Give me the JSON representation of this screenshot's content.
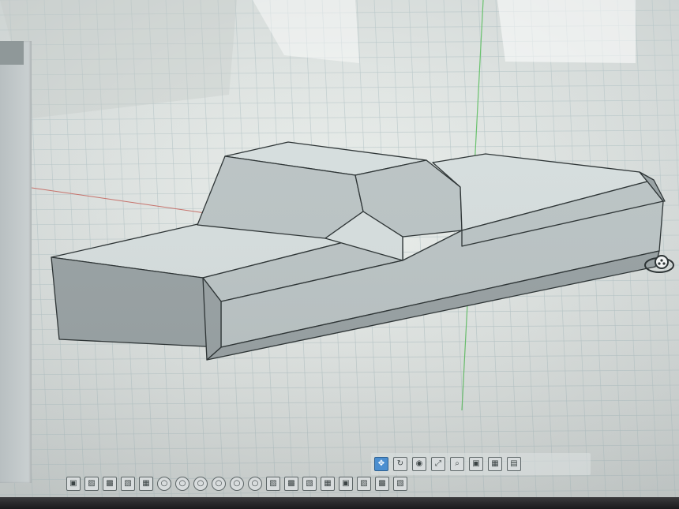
{
  "workspace": {
    "background": "#e4e8e6",
    "grid_color": "#b8c7c9",
    "axis_green": "#68c26c",
    "axis_red": "#c8716a"
  },
  "model": {
    "name_icon": "sedan-block-model",
    "face_light": "#d7dfdf",
    "face_mid": "#bcc5c6",
    "face_dark": "#9aa3a5",
    "edge_color": "#2b3233"
  },
  "view_cube": {
    "icon": "orbit-view-cube-icon"
  },
  "nav_toolbar": {
    "items": [
      {
        "icon": "pan-icon",
        "active": true
      },
      {
        "icon": "orbit-icon",
        "active": false
      },
      {
        "icon": "look-icon",
        "active": false
      },
      {
        "icon": "fit-icon",
        "active": false
      },
      {
        "icon": "zoom-icon",
        "active": false
      },
      {
        "icon": "display-mode-icon",
        "active": false
      },
      {
        "icon": "grid-settings-icon",
        "active": false
      },
      {
        "icon": "viewports-icon",
        "active": false
      }
    ]
  },
  "timeline": {
    "count": 19
  }
}
